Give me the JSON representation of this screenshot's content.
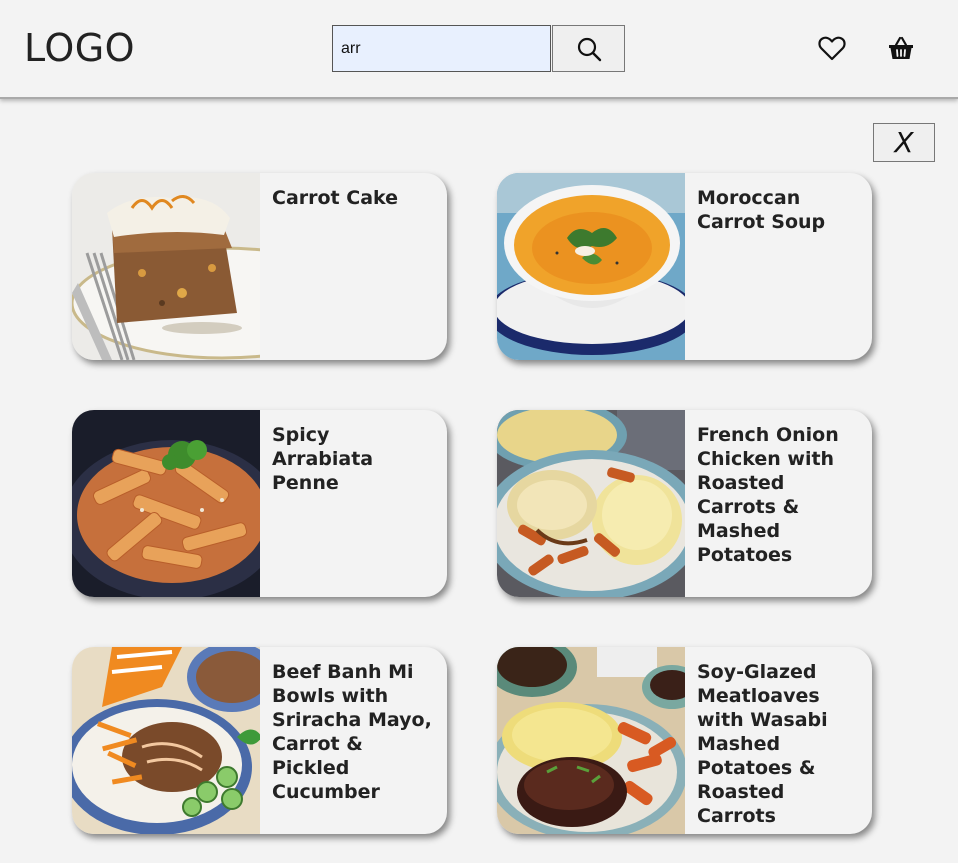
{
  "header": {
    "logo": "LOGO",
    "search": {
      "value": "arr",
      "placeholder": ""
    },
    "icons": {
      "search": "search-icon",
      "favorites": "heart-icon",
      "cart": "basket-icon"
    }
  },
  "close_label": "X",
  "recipes": [
    {
      "title": "Carrot Cake",
      "image": "carrot-cake-photo"
    },
    {
      "title": "Moroccan Carrot Soup",
      "image": "carrot-soup-photo"
    },
    {
      "title": "Spicy Arrabiata Penne",
      "image": "penne-photo"
    },
    {
      "title": "French Onion Chicken with Roasted Carrots & Mashed Potatoes",
      "image": "chicken-plate-photo"
    },
    {
      "title": "Beef Banh Mi Bowls with Sriracha Mayo, Carrot & Pickled Cucumber",
      "image": "banh-mi-bowl-photo"
    },
    {
      "title": "Soy-Glazed Meatloaves with Wasabi Mashed Potatoes & Roasted Carrots",
      "image": "meatloaf-plate-photo"
    }
  ]
}
